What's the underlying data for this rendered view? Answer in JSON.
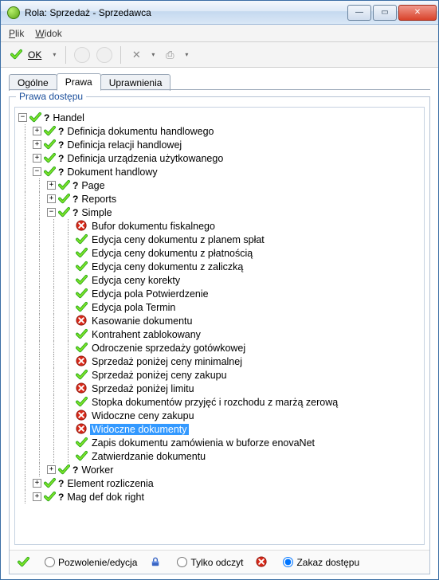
{
  "window": {
    "title": "Rola: Sprzedaż - Sprzedawca"
  },
  "menu": {
    "file": "Plik",
    "view": "Widok"
  },
  "toolbar": {
    "ok": "OK"
  },
  "tabs": {
    "general": "Ogólne",
    "rights": "Prawa",
    "permissions": "Uprawnienia"
  },
  "group": {
    "title": "Prawa dostępu"
  },
  "footer": {
    "allow": "Pozwolenie/edycja",
    "readonly": "Tylko odczyt",
    "deny": "Zakaz dostępu"
  },
  "tree": {
    "root": "Handel",
    "n1": "Definicja dokumentu handlowego",
    "n2": "Definicja relacji handlowej",
    "n3": "Definicja urządzenia użytkowanego",
    "n4": "Dokument handlowy",
    "n4a": "Page",
    "n4b": "Reports",
    "n4c": "Simple",
    "s1": "Bufor dokumentu fiskalnego",
    "s2": "Edycja ceny dokumentu z planem spłat",
    "s3": "Edycja ceny dokumentu z płatnością",
    "s4": "Edycja ceny dokumentu z zaliczką",
    "s5": "Edycja ceny korekty",
    "s6": "Edycja pola Potwierdzenie",
    "s7": "Edycja pola Termin",
    "s8": "Kasowanie dokumentu",
    "s9": "Kontrahent zablokowany",
    "s10": "Odroczenie sprzedaży gotówkowej",
    "s11": "Sprzedaż poniżej ceny minimalnej",
    "s12": "Sprzedaż poniżej ceny zakupu",
    "s13": "Sprzedaż poniżej limitu",
    "s14": "Stopka dokumentów przyjęć i rozchodu z marżą zerową",
    "s15": "Widoczne ceny zakupu",
    "s16": "Widoczne dokumenty",
    "s17": "Zapis dokumentu zamówienia w buforze enovaNet",
    "s18": "Zatwierdzanie dokumentu",
    "n4d": "Worker",
    "n5": "Element rozliczenia",
    "n6": "Mag def dok right"
  }
}
